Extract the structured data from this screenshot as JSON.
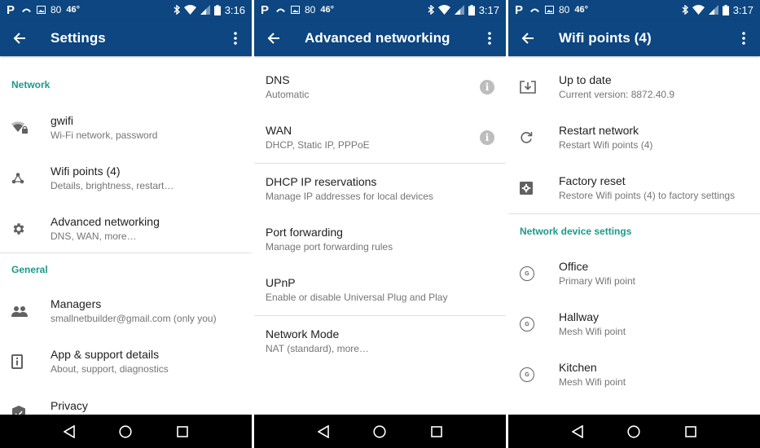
{
  "colors": {
    "appbar": "#0d4680",
    "accent": "#1a9a8a",
    "primary_text": "#212121",
    "secondary_text": "#757575",
    "navbar": "#000000"
  },
  "panels": [
    {
      "status": {
        "notif_count": "80",
        "temp": "46°",
        "time": "3:16"
      },
      "appbar": {
        "title": "Settings",
        "back_icon": "arrow-back-icon",
        "more_icon": "more-vert-icon"
      },
      "sections": [
        {
          "header": "Network",
          "items": [
            {
              "icon": "wifi-lock-icon",
              "title": "gwifi",
              "subtitle": "Wi-Fi network, password"
            },
            {
              "icon": "mesh-network-icon",
              "title": "Wifi points (4)",
              "subtitle": "Details, brightness, restart…"
            },
            {
              "icon": "gear-icon",
              "title": "Advanced networking",
              "subtitle": "DNS, WAN, more…"
            }
          ]
        },
        {
          "header": "General",
          "items": [
            {
              "icon": "people-icon",
              "title": "Managers",
              "subtitle": "smallnetbuilder@gmail.com (only you)"
            },
            {
              "icon": "device-info-icon",
              "title": "App & support details",
              "subtitle": "About, support, diagnostics"
            },
            {
              "icon": "shield-check-icon",
              "title": "Privacy",
              "subtitle": ""
            }
          ]
        }
      ]
    },
    {
      "status": {
        "notif_count": "80",
        "temp": "46°",
        "time": "3:17"
      },
      "appbar": {
        "title": "Advanced networking",
        "back_icon": "arrow-back-icon",
        "more_icon": "more-vert-icon"
      },
      "groups": [
        {
          "items": [
            {
              "title": "DNS",
              "subtitle": "Automatic",
              "info": "i"
            },
            {
              "title": "WAN",
              "subtitle": "DHCP, Static IP, PPPoE",
              "info": "i"
            }
          ]
        },
        {
          "items": [
            {
              "title": "DHCP IP reservations",
              "subtitle": "Manage IP addresses for local devices"
            },
            {
              "title": "Port forwarding",
              "subtitle": "Manage port forwarding rules"
            },
            {
              "title": "UPnP",
              "subtitle": "Enable or disable Universal Plug and Play"
            }
          ]
        },
        {
          "items": [
            {
              "title": "Network Mode",
              "subtitle": "NAT (standard), more…"
            }
          ]
        }
      ]
    },
    {
      "status": {
        "notif_count": "80",
        "temp": "46°",
        "time": "3:17"
      },
      "appbar": {
        "title": "Wifi points (4)",
        "back_icon": "arrow-back-icon",
        "more_icon": "more-vert-icon"
      },
      "actions": [
        {
          "icon": "system-update-icon",
          "title": "Up to date",
          "subtitle": "Current version: 8872.40.9"
        },
        {
          "icon": "refresh-icon",
          "title": "Restart network",
          "subtitle": "Restart Wifi points (4)"
        },
        {
          "icon": "factory-reset-icon",
          "title": "Factory reset",
          "subtitle": "Restore Wifi points (4) to factory settings"
        }
      ],
      "device_section": {
        "header": "Network device settings",
        "items": [
          {
            "icon": "google-wifi-point-icon",
            "glyph": "G",
            "title": "Office",
            "subtitle": "Primary Wifi point"
          },
          {
            "icon": "google-wifi-point-icon",
            "glyph": "G",
            "title": "Hallway",
            "subtitle": "Mesh Wifi point"
          },
          {
            "icon": "google-wifi-point-icon",
            "glyph": "G",
            "title": "Kitchen",
            "subtitle": "Mesh Wifi point"
          }
        ]
      }
    }
  ],
  "navbar": {
    "back": "nav-back-icon",
    "home": "nav-home-icon",
    "recents": "nav-recents-icon"
  }
}
